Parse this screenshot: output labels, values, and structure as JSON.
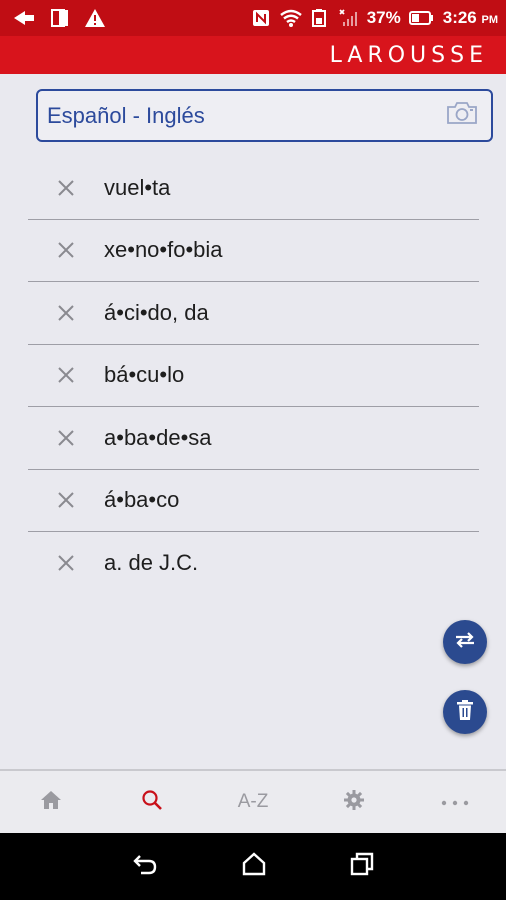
{
  "status_bar": {
    "battery": "37%",
    "time": "3:26",
    "meridiem": "PM",
    "icons": [
      "back-arrow-icon",
      "sim-card-icon",
      "warning-icon",
      "nfc-icon",
      "wifi-icon",
      "battery-saver-icon",
      "signal-icon",
      "battery-icon"
    ]
  },
  "app_bar": {
    "brand": "LAROUSSE",
    "color": "#d8141c"
  },
  "search": {
    "language_pair": "Español - Inglés",
    "icon": "camera-icon",
    "accent": "#2c4a9c"
  },
  "history": {
    "items": [
      {
        "word": "vuel•ta"
      },
      {
        "word": "xe•no•fo•bia"
      },
      {
        "word": "á•ci•do, da"
      },
      {
        "word": "bá•cu•lo"
      },
      {
        "word": "a•ba•de•sa"
      },
      {
        "word": "á•ba•co"
      },
      {
        "word": "a. de J.C."
      }
    ]
  },
  "fabs": {
    "swap": "swap-icon",
    "delete": "trash-icon",
    "color": "#2b4a8f"
  },
  "bottom_nav": {
    "items": [
      {
        "name": "home",
        "icon": "home-icon",
        "active": false
      },
      {
        "name": "search",
        "icon": "search-icon",
        "active": true
      },
      {
        "name": "a-z",
        "label": "A-Z",
        "active": false
      },
      {
        "name": "settings",
        "icon": "gear-icon",
        "active": false
      },
      {
        "name": "more",
        "icon": "more-icon",
        "active": false
      }
    ],
    "active_color": "#c8101a"
  },
  "system_nav": {
    "icons": [
      "back-icon",
      "home-icon",
      "recents-icon"
    ]
  }
}
